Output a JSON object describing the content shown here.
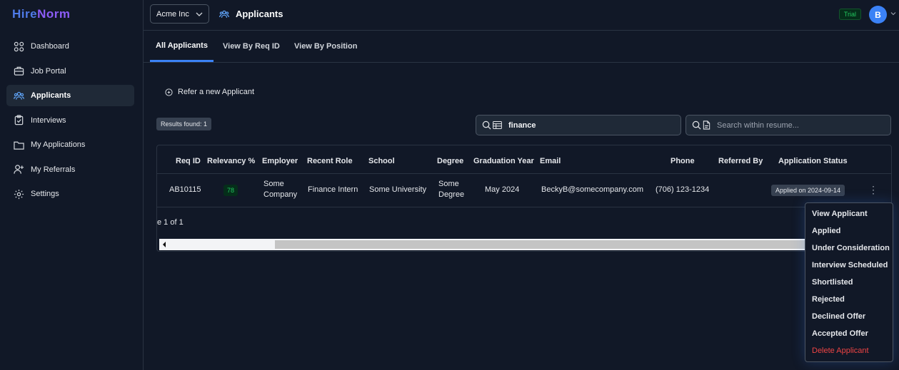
{
  "logo": {
    "part1": "Hire",
    "part2": "Norm"
  },
  "sidebar": {
    "items": [
      {
        "label": "Dashboard",
        "icon": "grid-icon"
      },
      {
        "label": "Job Portal",
        "icon": "briefcase-icon"
      },
      {
        "label": "Applicants",
        "icon": "users-icon"
      },
      {
        "label": "Interviews",
        "icon": "clipboard-icon"
      },
      {
        "label": "My Applications",
        "icon": "folder-icon"
      },
      {
        "label": "My Referrals",
        "icon": "user-plus-icon"
      },
      {
        "label": "Settings",
        "icon": "gear-icon"
      }
    ]
  },
  "header": {
    "org": "Acme Inc",
    "title": "Applicants",
    "trial": "Trial",
    "avatar_initial": "B"
  },
  "tabs": [
    "All Applicants",
    "View By Req ID",
    "View By Position"
  ],
  "refer_label": "Refer a new Applicant",
  "results_label": "Results found: 1",
  "search": {
    "value": "finance",
    "resume_placeholder": "Search within resume..."
  },
  "table": {
    "headers": [
      "Req ID",
      "Relevancy %",
      "Employer",
      "Recent Role",
      "School",
      "Degree",
      "Graduation Year",
      "Email",
      "Phone",
      "Referred By",
      "Application Status"
    ],
    "row": {
      "req_id": "AB10115",
      "relevancy": "78",
      "employer_line1": "Some",
      "employer_line2": "Company",
      "role": "Finance Intern",
      "school": "Some University",
      "degree_line1": "Some",
      "degree_line2": "Degree",
      "grad_year": "May 2024",
      "email": "BeckyB@somecompany.com",
      "phone": "(706) 123-1234",
      "referred_by": "",
      "status": "Applied on 2024-09-14"
    },
    "page_info": "e 1 of 1"
  },
  "menu": {
    "items": [
      "View Applicant",
      "Applied",
      "Under Consideration",
      "Interview Scheduled",
      "Shortlisted",
      "Rejected",
      "Declined Offer",
      "Accepted Offer"
    ],
    "danger": "Delete Applicant"
  },
  "colors": {
    "accent": "#3b82f6",
    "success": "#22c55e",
    "danger": "#ef4444",
    "background": "#111827"
  }
}
